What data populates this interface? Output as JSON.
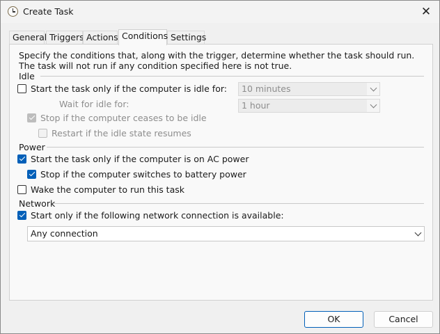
{
  "window": {
    "title": "Create Task",
    "close_glyph": "✕"
  },
  "tabs": [
    {
      "label": "General"
    },
    {
      "label": "Triggers"
    },
    {
      "label": "Actions"
    },
    {
      "label": "Conditions"
    },
    {
      "label": "Settings"
    }
  ],
  "active_tab": "Conditions",
  "description": "Specify the conditions that, along with the trigger, determine whether the task should run.  The task will not run  if any condition specified here is not true.",
  "idle": {
    "group_label": "Idle",
    "start_only_idle": {
      "label": "Start the task only if the computer is idle for:",
      "checked": false,
      "enabled": true
    },
    "idle_for": {
      "value": "10 minutes",
      "enabled": false
    },
    "wait_for_idle_label": "Wait for idle for:",
    "wait_for_idle": {
      "value": "1 hour",
      "enabled": false
    },
    "stop_if_ceases": {
      "label": "Stop if the computer ceases to be idle",
      "checked": true,
      "enabled": false
    },
    "restart_if_resumes": {
      "label": "Restart if the idle state resumes",
      "checked": false,
      "enabled": false
    }
  },
  "power": {
    "group_label": "Power",
    "ac_power": {
      "label": "Start the task only if the computer is on AC power",
      "checked": true,
      "enabled": true
    },
    "battery_stop": {
      "label": "Stop if the computer switches to battery power",
      "checked": true,
      "enabled": true
    },
    "wake": {
      "label": "Wake the computer to run this task",
      "checked": false,
      "enabled": true
    }
  },
  "network": {
    "group_label": "Network",
    "start_only_network": {
      "label": "Start only if the following network connection is available:",
      "checked": true,
      "enabled": true
    },
    "connection": {
      "value": "Any connection"
    }
  },
  "buttons": {
    "ok": "OK",
    "cancel": "Cancel"
  },
  "colors": {
    "accent": "#005fb8",
    "disabled_text": "#8d8d8d",
    "panel_bg": "#f9f9f9",
    "window_bg": "#f0f0f0"
  },
  "icons": {
    "title_icon": "task-scheduler-clock-icon",
    "close_icon": "close-icon",
    "combo_chevron": "chevron-down-icon"
  }
}
